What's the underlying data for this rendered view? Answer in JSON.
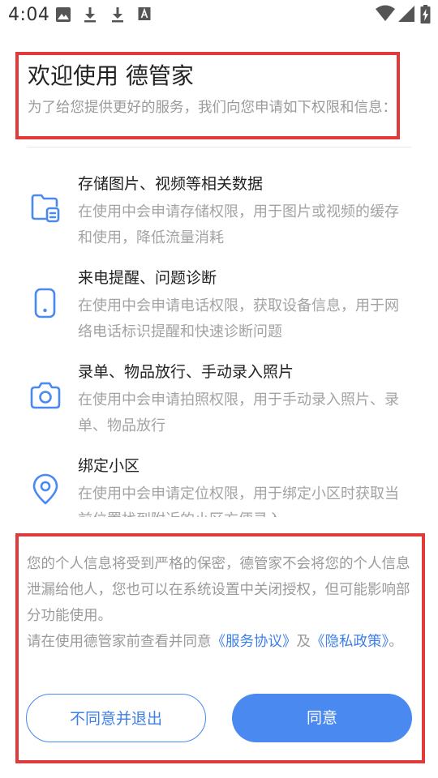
{
  "status_bar": {
    "time": "4:04",
    "icons_left": [
      "image-icon",
      "download-icon",
      "download-icon",
      "a-box-icon"
    ],
    "icons_right": [
      "wifi-icon",
      "signal-icon",
      "battery-charging-icon"
    ]
  },
  "header": {
    "title": "欢迎使用 德管家",
    "subtitle": "为了给您提供更好的服务，我们向您申请如下权限和信息："
  },
  "permissions": [
    {
      "icon": "folder-file-icon",
      "title": "存储图片、视频等相关数据",
      "desc": "在使用中会申请存储权限，用于图片或视频的缓存和使用，降低流量消耗"
    },
    {
      "icon": "phone-device-icon",
      "title": "来电提醒、问题诊断",
      "desc": "在使用中会申请电话权限，获取设备信息，用于网络电话标识提醒和快速诊断问题"
    },
    {
      "icon": "camera-icon",
      "title": "录单、物品放行、手动录入照片",
      "desc": "在使用中会申请拍照权限，用于手动录入照片、录单、物品放行"
    },
    {
      "icon": "location-pin-icon",
      "title": "绑定小区",
      "desc": "在使用中会申请定位权限，用于绑定小区时获取当前位置找到附近的小区方便录入"
    }
  ],
  "notice": {
    "privacy_text": "您的个人信息将受到严格的保密，德管家不会将您的个人信息泄漏给他人，您也可以在系统设置中关闭授权，但可能影响部分功能使用。",
    "consent_prefix": "请在使用德管家前查看并同意",
    "service_link": "《服务协议》",
    "and_text": "及",
    "privacy_link": "《隐私政策》",
    "end_text": "。"
  },
  "buttons": {
    "decline": "不同意并退出",
    "agree": "同意"
  },
  "colors": {
    "accent": "#4a89f0",
    "highlight_border": "#e23a3a"
  }
}
